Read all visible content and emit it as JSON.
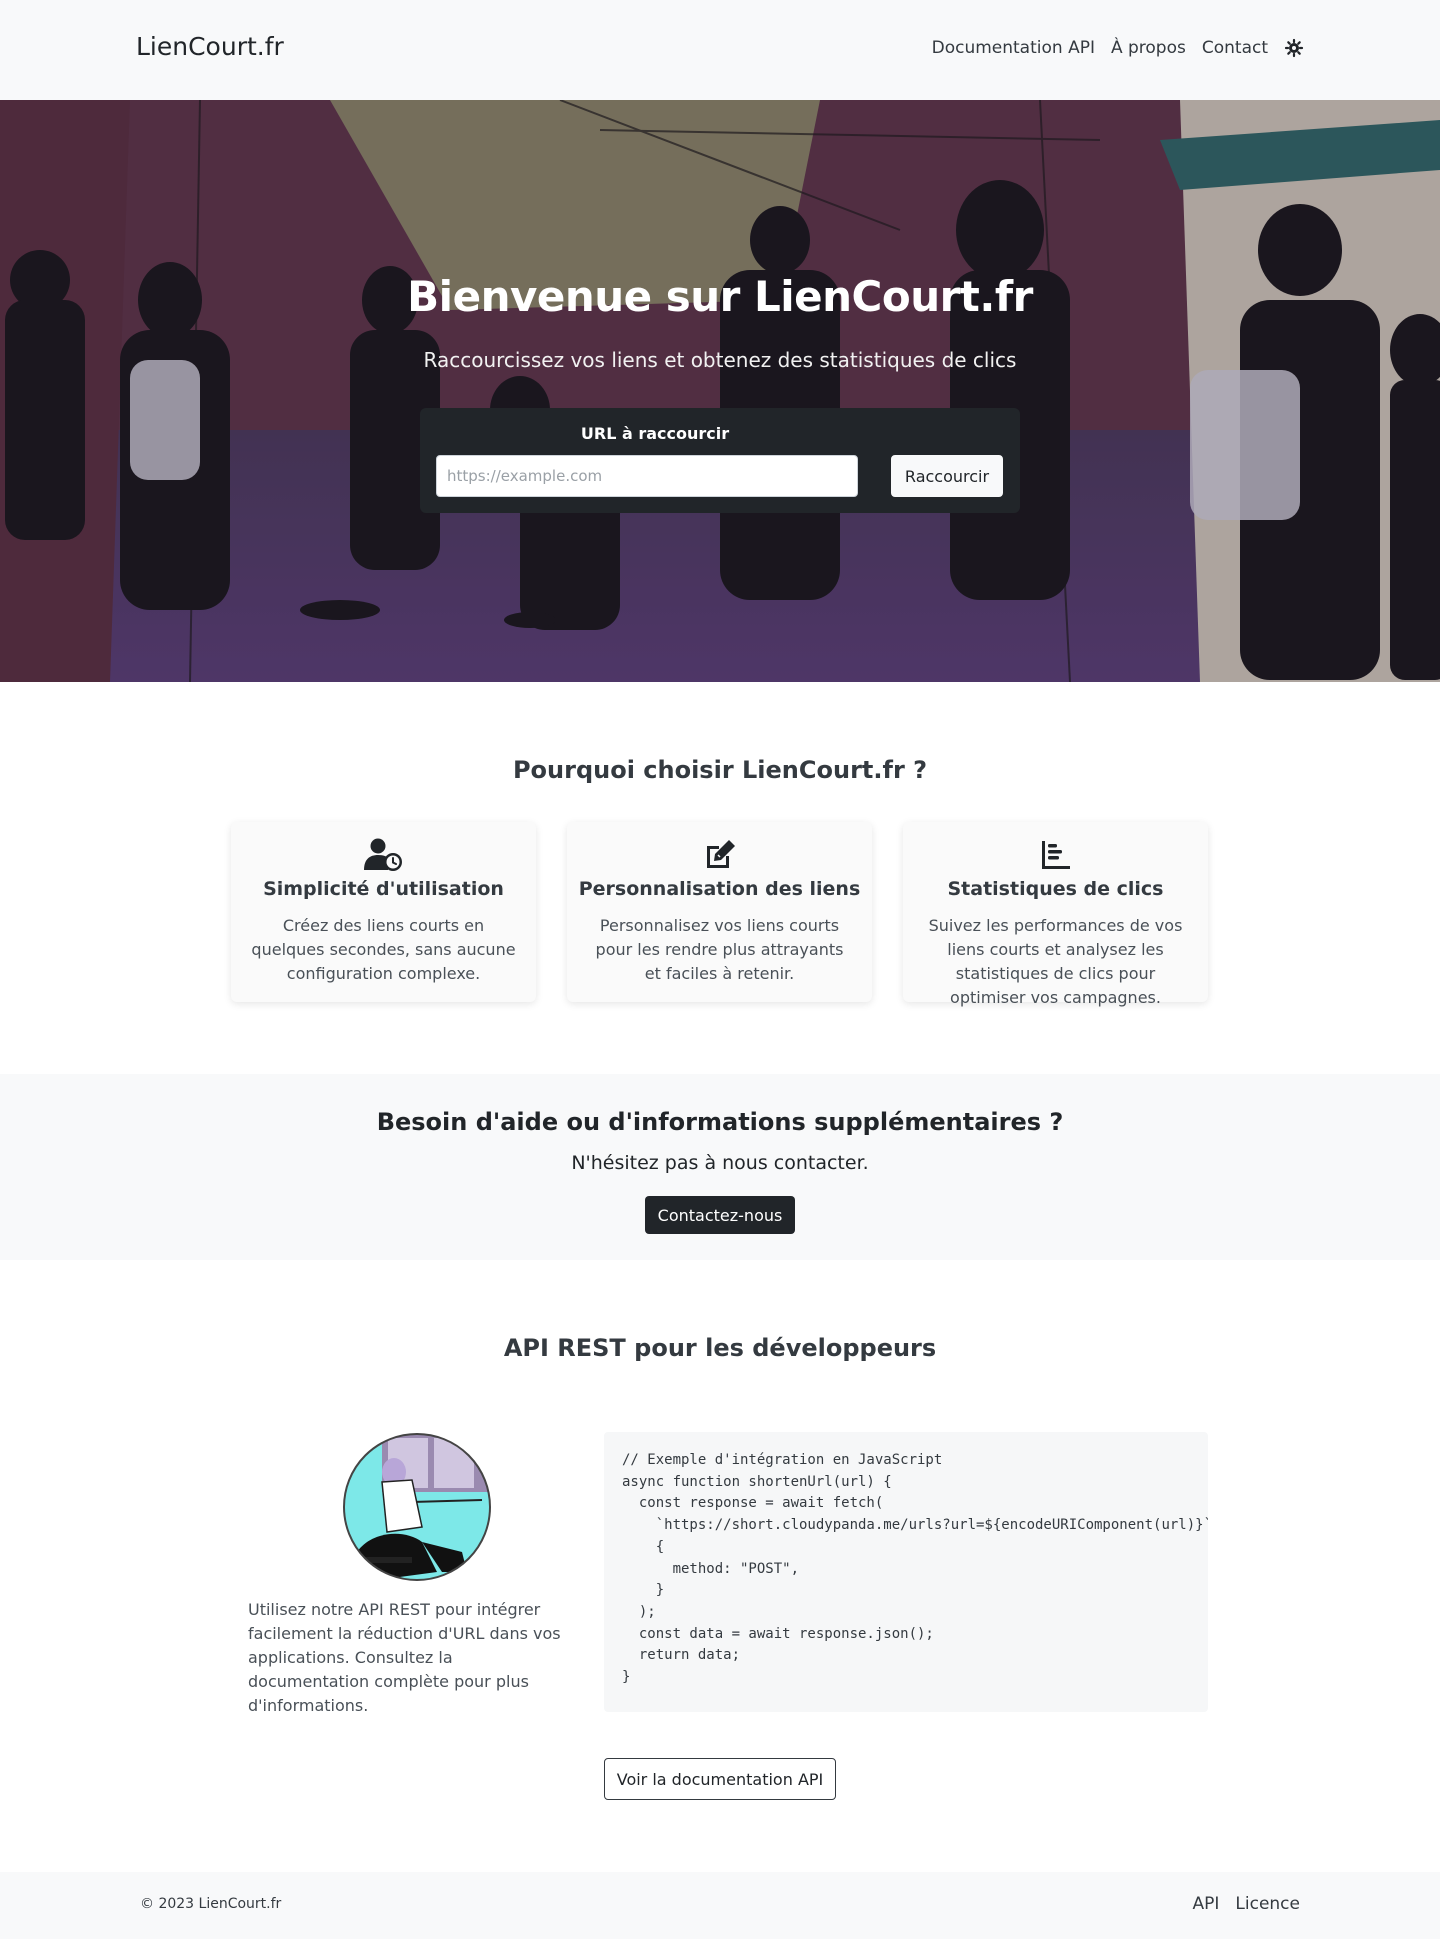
{
  "navbar": {
    "brand": "LienCourt.fr",
    "links": [
      "Documentation API",
      "À propos",
      "Contact"
    ],
    "theme_icon": "sun-gear-icon"
  },
  "hero": {
    "title": "Bienvenue sur LienCourt.fr",
    "subtitle": "Raccourcissez vos liens et obtenez des statistiques de clics",
    "form": {
      "label": "URL à raccourcir",
      "placeholder": "https://example.com",
      "value": "",
      "button": "Raccourcir"
    }
  },
  "features": {
    "title": "Pourquoi choisir LienCourt.fr ?",
    "cards": [
      {
        "icon": "user-clock-icon",
        "title": "Simplicité d'utilisation",
        "text": "Créez des liens courts en quelques secondes, sans aucune configuration complexe."
      },
      {
        "icon": "edit-icon",
        "title": "Personnalisation des liens",
        "text": "Personnalisez vos liens courts pour les rendre plus attrayants et faciles à retenir."
      },
      {
        "icon": "chart-bar-icon",
        "title": "Statistiques de clics",
        "text": "Suivez les performances de vos liens courts et analysez les statistiques de clics pour optimiser vos campagnes."
      }
    ]
  },
  "help": {
    "title": "Besoin d'aide ou d'informations supplémentaires ?",
    "text": "N'hésitez pas à nous contacter.",
    "button": "Contactez-nous"
  },
  "api": {
    "title": "API REST pour les développeurs",
    "text": "Utilisez notre API REST pour intégrer facilement la réduction d'URL dans vos applications. Consultez la documentation complète pour plus d'informations.",
    "code": "// Exemple d'intégration en JavaScript\nasync function shortenUrl(url) {\n  const response = await fetch(\n    `https://short.cloudypanda.me/urls?url=${encodeURIComponent(url)}`,\n    {\n      method: \"POST\",\n    }\n  );\n  const data = await response.json();\n  return data;\n}",
    "button": "Voir la documentation API"
  },
  "footer": {
    "copyright": "© 2023 LienCourt.fr",
    "links": [
      "API",
      "Licence"
    ]
  }
}
